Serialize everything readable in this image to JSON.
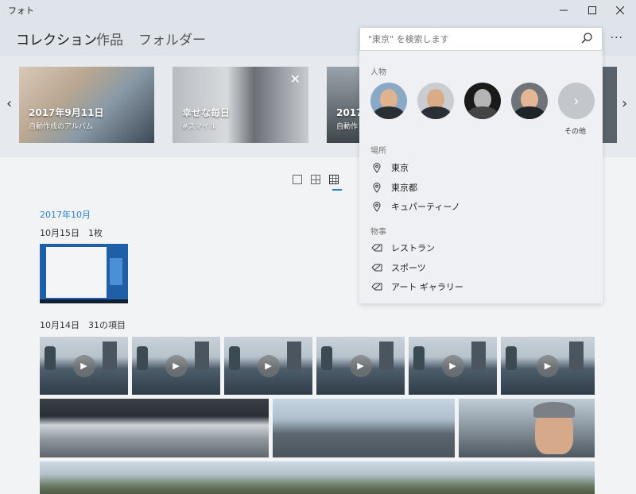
{
  "window": {
    "title": "フォト"
  },
  "nav": {
    "tabs": [
      "コレクション",
      "作品",
      "フォルダー"
    ],
    "more": "···"
  },
  "highlights": [
    {
      "title": "2017年9月11日",
      "subtitle": "自動作成のアルバム"
    },
    {
      "title": "幸せな毎日",
      "subtitle": "#スマイル"
    },
    {
      "title": "2017年",
      "subtitle": "自動作"
    }
  ],
  "search": {
    "placeholder": "\"東京\" を検索します",
    "people_label": "人物",
    "people_more": "その他",
    "places_label": "場所",
    "places": [
      "東京",
      "東京都",
      "キュパーティーノ"
    ],
    "things_label": "物事",
    "things": [
      "レストラン",
      "スポーツ",
      "アート ギャラリー"
    ]
  },
  "timeline": {
    "month": "2017年10月",
    "groups": [
      {
        "label": "10月15日　1枚"
      },
      {
        "label": "10月14日　31の項目"
      }
    ]
  },
  "colors": {
    "accent": "#2a7fd1",
    "header_bg": "#dfe3ea",
    "content_bg": "#f2f3f5"
  }
}
